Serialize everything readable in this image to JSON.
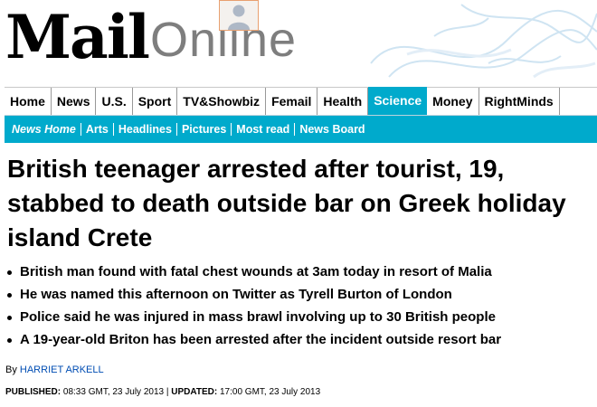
{
  "masthead": {
    "logo_primary": "Mail",
    "logo_secondary": "Online"
  },
  "nav_primary": [
    {
      "label": "Home",
      "active": false
    },
    {
      "label": "News",
      "active": false
    },
    {
      "label": "U.S.",
      "active": false
    },
    {
      "label": "Sport",
      "active": false
    },
    {
      "label": "TV&Showbiz",
      "active": false
    },
    {
      "label": "Femail",
      "active": false
    },
    {
      "label": "Health",
      "active": false
    },
    {
      "label": "Science",
      "active": true
    },
    {
      "label": "Money",
      "active": false
    },
    {
      "label": "RightMinds",
      "active": false
    }
  ],
  "nav_secondary": [
    {
      "label": "News Home"
    },
    {
      "label": "Arts"
    },
    {
      "label": "Headlines"
    },
    {
      "label": "Pictures"
    },
    {
      "label": "Most read"
    },
    {
      "label": "News Board"
    }
  ],
  "article": {
    "headline": "British teenager arrested after tourist, 19, stabbed to death outside bar on Greek holiday island Crete",
    "bullets": [
      "British man found with fatal chest wounds at 3am today in resort of Malia",
      "He was named this afternoon on Twitter as Tyrell Burton of London",
      "Police said he was injured in mass brawl involving up to 30 British people",
      "A 19-year-old Briton has been arrested after the incident outside resort bar"
    ],
    "byline_prefix": "By",
    "author": "HARRIET ARKELL",
    "published_label": "PUBLISHED:",
    "published_value": "08:33 GMT, 23 July 2013",
    "separator": "|",
    "updated_label": "UPDATED:",
    "updated_value": "17:00 GMT, 23 July 2013"
  },
  "colors": {
    "accent": "#00aacc",
    "author_link": "#004db3",
    "logo_secondary": "#7e7e7e"
  },
  "icons": {
    "avatar": "user-avatar-icon"
  }
}
